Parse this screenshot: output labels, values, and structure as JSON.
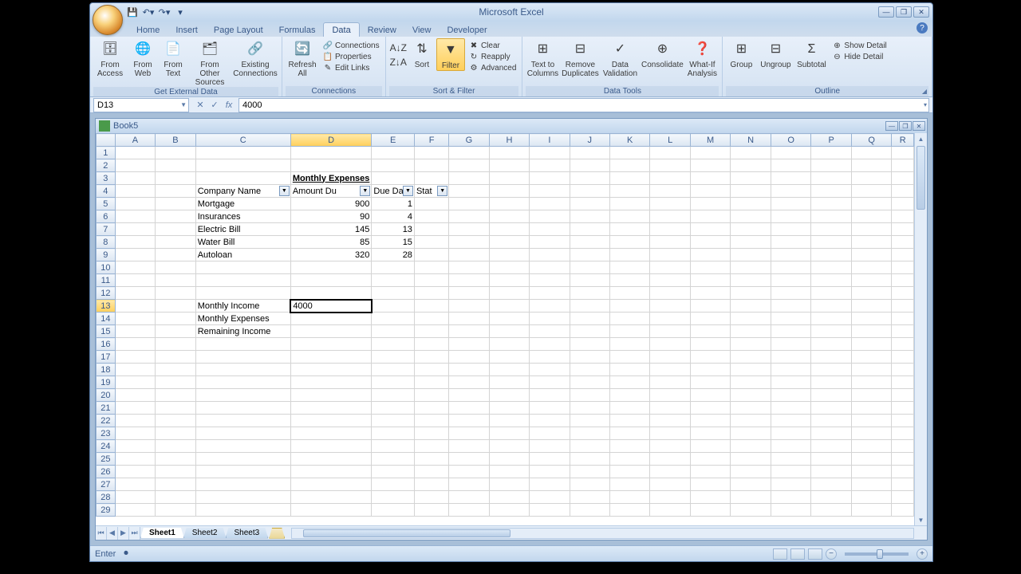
{
  "app_title": "Microsoft Excel",
  "tabs": [
    "Home",
    "Insert",
    "Page Layout",
    "Formulas",
    "Data",
    "Review",
    "View",
    "Developer"
  ],
  "active_tab": "Data",
  "ribbon": {
    "get_external": {
      "label": "Get External Data",
      "from_access": "From\nAccess",
      "from_web": "From\nWeb",
      "from_text": "From\nText",
      "from_other": "From Other\nSources",
      "existing": "Existing\nConnections"
    },
    "connections": {
      "label": "Connections",
      "refresh": "Refresh\nAll",
      "connections": "Connections",
      "properties": "Properties",
      "edit_links": "Edit Links"
    },
    "sort_filter": {
      "label": "Sort & Filter",
      "sort": "Sort",
      "filter": "Filter",
      "clear": "Clear",
      "reapply": "Reapply",
      "advanced": "Advanced"
    },
    "data_tools": {
      "label": "Data Tools",
      "text_to_columns": "Text to\nColumns",
      "remove_dup": "Remove\nDuplicates",
      "validation": "Data\nValidation",
      "consolidate": "Consolidate",
      "whatif": "What-If\nAnalysis"
    },
    "outline": {
      "label": "Outline",
      "group": "Group",
      "ungroup": "Ungroup",
      "subtotal": "Subtotal",
      "show_detail": "Show Detail",
      "hide_detail": "Hide Detail"
    }
  },
  "name_box": "D13",
  "formula": "4000",
  "workbook_title": "Book5",
  "columns": [
    "A",
    "B",
    "C",
    "D",
    "E",
    "F",
    "G",
    "H",
    "I",
    "J",
    "K",
    "L",
    "M",
    "N",
    "O",
    "P",
    "Q",
    "R"
  ],
  "active_col": "D",
  "active_row": 13,
  "col_widths": {
    "A": 52,
    "B": 52,
    "C": 120,
    "D": 72,
    "E": 54,
    "F": 44,
    "G": 52,
    "H": 52,
    "I": 52,
    "J": 52,
    "K": 52,
    "L": 52,
    "M": 52,
    "N": 52,
    "O": 52,
    "P": 52,
    "Q": 52,
    "R": 28
  },
  "row_count": 29,
  "cells": {
    "3": {
      "D": {
        "v": "Monthly Expenses",
        "cls": "title-cell",
        "overflow_from": "C"
      }
    },
    "4": {
      "C": {
        "v": "Company Name",
        "filter": true
      },
      "D": {
        "v": "Amount Du",
        "filter": true
      },
      "E": {
        "v": "Due Da",
        "filter": true
      },
      "F": {
        "v": "Stat",
        "filter": true
      }
    },
    "5": {
      "C": {
        "v": "Mortgage"
      },
      "D": {
        "v": "900",
        "cls": "num"
      },
      "E": {
        "v": "1",
        "cls": "num"
      }
    },
    "6": {
      "C": {
        "v": "Insurances"
      },
      "D": {
        "v": "90",
        "cls": "num"
      },
      "E": {
        "v": "4",
        "cls": "num"
      }
    },
    "7": {
      "C": {
        "v": "Electric Bill"
      },
      "D": {
        "v": "145",
        "cls": "num"
      },
      "E": {
        "v": "13",
        "cls": "num"
      }
    },
    "8": {
      "C": {
        "v": "Water Bill"
      },
      "D": {
        "v": "85",
        "cls": "num"
      },
      "E": {
        "v": "15",
        "cls": "num"
      }
    },
    "9": {
      "C": {
        "v": "Autoloan"
      },
      "D": {
        "v": "320",
        "cls": "num"
      },
      "E": {
        "v": "28",
        "cls": "num"
      }
    },
    "13": {
      "C": {
        "v": "Monthly Income"
      },
      "D": {
        "v": "4000",
        "cls": "editing"
      }
    },
    "14": {
      "C": {
        "v": "Monthly Expenses"
      }
    },
    "15": {
      "C": {
        "v": "Remaining Income"
      }
    }
  },
  "sheets": [
    "Sheet1",
    "Sheet2",
    "Sheet3"
  ],
  "active_sheet": "Sheet1",
  "status": "Enter"
}
